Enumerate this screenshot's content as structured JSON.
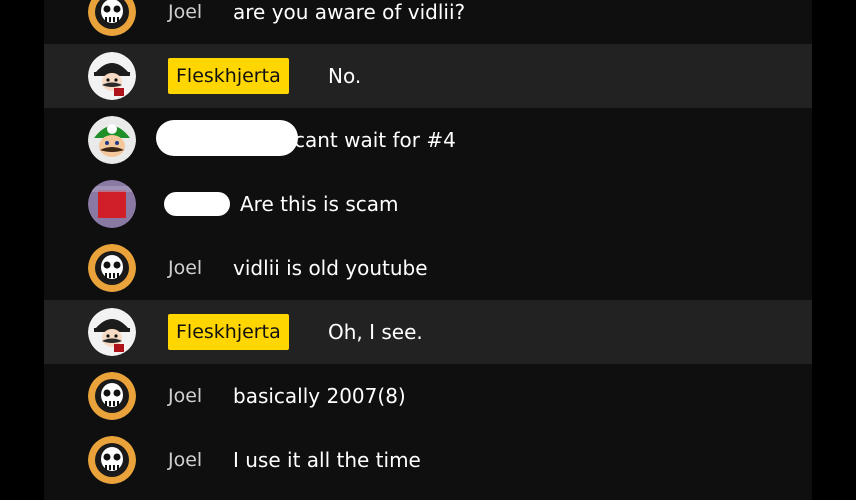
{
  "chat": {
    "messages": [
      {
        "author": "Joel",
        "text": "are you aware of vidlii?",
        "avatar": "skull-mascot-avatar",
        "owner": false,
        "highlighted": false
      },
      {
        "author": "Fleskhjerta",
        "text": "No.",
        "avatar": "mustache-hat-avatar",
        "owner": true,
        "highlighted": true
      },
      {
        "author": "",
        "text": "cant wait for #4",
        "avatar": "green-cap-avatar",
        "owner": false,
        "highlighted": false,
        "author_redacted": true
      },
      {
        "author": "",
        "text": "Are this is scam",
        "avatar": "red-square-avatar",
        "owner": false,
        "highlighted": false,
        "author_redacted": true
      },
      {
        "author": "Joel",
        "text": "vidlii is old youtube",
        "avatar": "skull-mascot-avatar",
        "owner": false,
        "highlighted": false
      },
      {
        "author": "Fleskhjerta",
        "text": "Oh, I see.",
        "avatar": "mustache-hat-avatar",
        "owner": true,
        "highlighted": true
      },
      {
        "author": "Joel",
        "text": "basically 2007(8)",
        "avatar": "skull-mascot-avatar",
        "owner": false,
        "highlighted": false
      },
      {
        "author": "Joel",
        "text": "I use it all the time",
        "avatar": "skull-mascot-avatar",
        "owner": false,
        "highlighted": false
      }
    ]
  },
  "colors": {
    "chat_background": "#0f0f0f",
    "highlight_row": "#222222",
    "owner_badge": "#ffd600",
    "author_text": "#d0d0d0",
    "message_text": "#ffffff"
  }
}
